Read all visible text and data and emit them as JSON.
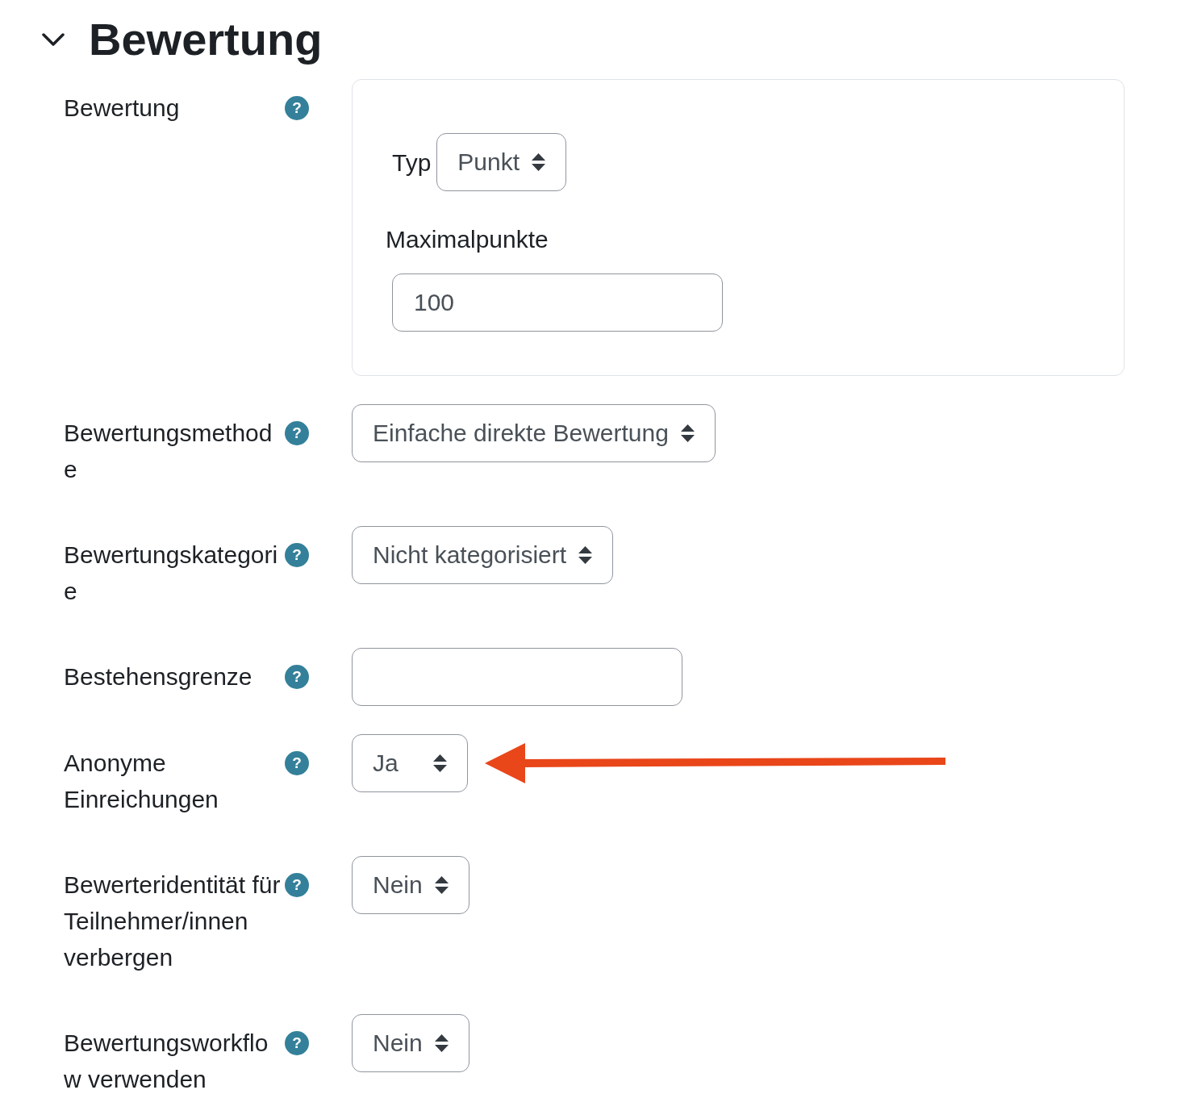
{
  "section": {
    "title": "Bewertung",
    "expanded": true
  },
  "rows": [
    {
      "kind": "group",
      "label": "Bewertung",
      "help": "?",
      "annotation_arrow": false,
      "fields": [
        {
          "kind": "select",
          "label": "Typ",
          "value": "Punkt"
        },
        {
          "kind": "input",
          "label": "Maximalpunkte",
          "value": "100"
        }
      ]
    },
    {
      "kind": "select",
      "label": "Bewertungsmethode",
      "help": "?",
      "value": "Einfache direkte Bewertung",
      "annotation_arrow": false
    },
    {
      "kind": "select",
      "label": "Bewertungskategorie",
      "help": "?",
      "value": "Nicht kategorisiert",
      "annotation_arrow": false
    },
    {
      "kind": "input",
      "label": "Bestehensgrenze",
      "help": "?",
      "annotation_arrow": false
    },
    {
      "kind": "select",
      "label": "Anonyme Einreichungen",
      "help": "?",
      "value": "Ja",
      "annotation_arrow": true
    },
    {
      "kind": "select",
      "label": "Bewerteridentität für Teilnehmer/innen verbergen",
      "help": "?",
      "value": "Nein",
      "annotation_arrow": false
    },
    {
      "kind": "select",
      "label": "Bewertungsworkflow verwenden",
      "help": "?",
      "value": "Nein",
      "annotation_arrow": false
    }
  ]
}
